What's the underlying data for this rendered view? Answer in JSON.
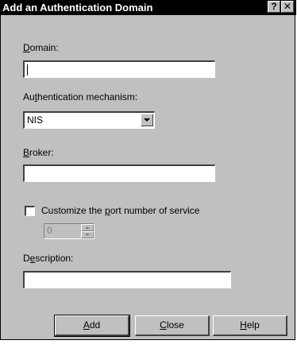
{
  "dialog": {
    "title": "Add an Authentication Domain",
    "help_button": "?",
    "close_button": "✕"
  },
  "domain": {
    "label": "Domain:",
    "mnemonic": "D",
    "label_rest": "omain:",
    "value": ""
  },
  "auth_mechanism": {
    "label_pre": "Au",
    "mnemonic": "t",
    "label_rest": "hentication mechanism:",
    "selected": "NIS"
  },
  "broker": {
    "mnemonic": "B",
    "label_rest": "roker:",
    "value": ""
  },
  "customize_port": {
    "label_pre": "Customize the ",
    "mnemonic": "p",
    "label_rest": "ort number of service",
    "checked": false,
    "port_value": "0"
  },
  "description": {
    "label_pre": "D",
    "mnemonic": "e",
    "label_rest": "scription:",
    "value": ""
  },
  "buttons": {
    "add_mnemonic": "A",
    "add_rest": "dd",
    "close_mnemonic": "C",
    "close_rest": "lose",
    "help_mnemonic": "H",
    "help_rest": "elp"
  },
  "colors": {
    "face": "#c0c0c0",
    "title_bar": "#000000",
    "title_text": "#ffffff",
    "field": "#ffffff",
    "disabled_text": "#808080"
  }
}
